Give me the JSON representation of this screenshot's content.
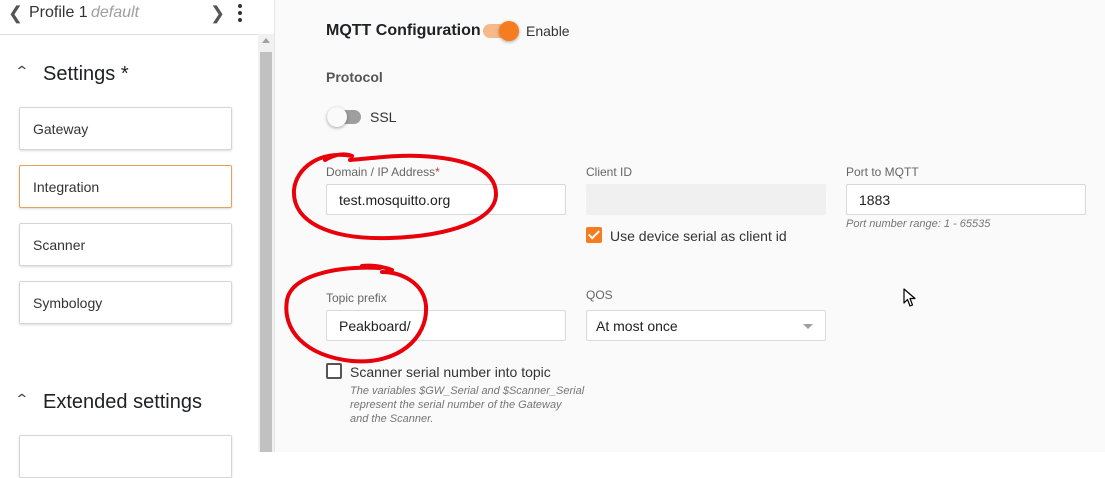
{
  "profile": {
    "name": "Profile 1",
    "tag": "default"
  },
  "sidebar": {
    "settings_title": "Settings *",
    "items": [
      {
        "label": "Gateway",
        "active": false
      },
      {
        "label": "Integration",
        "active": true
      },
      {
        "label": "Scanner",
        "active": false
      },
      {
        "label": "Symbology",
        "active": false
      }
    ],
    "extended_title": "Extended settings"
  },
  "mqtt": {
    "title": "MQTT Configuration",
    "enable_label": "Enable",
    "enabled": true,
    "protocol_label": "Protocol",
    "ssl_label": "SSL",
    "ssl_enabled": false,
    "domain": {
      "label": "Domain / IP Address",
      "required_mark": "*",
      "value": "test.mosquitto.org"
    },
    "client_id": {
      "label": "Client ID",
      "value": "",
      "checkbox_label": "Use device serial as client id",
      "checked": true
    },
    "port": {
      "label": "Port to MQTT",
      "value": "1883",
      "hint": "Port number range: 1 - 65535"
    },
    "topic_prefix": {
      "label": "Topic prefix",
      "value": "Peakboard/"
    },
    "qos": {
      "label": "QOS",
      "value": "At most once"
    },
    "serial_topic": {
      "label": "Scanner serial number into topic",
      "checked": false,
      "hint_lines": [
        "The variables $GW_Serial and $Scanner_Serial",
        "represent the serial number of the Gateway",
        "and the Scanner."
      ]
    }
  },
  "colors": {
    "accent": "#f57c1f",
    "annotation": "#e8000b"
  },
  "icons": [
    "chevron-left-icon",
    "chevron-right-icon",
    "more-vert-icon",
    "chevron-up-icon",
    "dropdown-caret-icon",
    "mouse-cursor-icon"
  ]
}
